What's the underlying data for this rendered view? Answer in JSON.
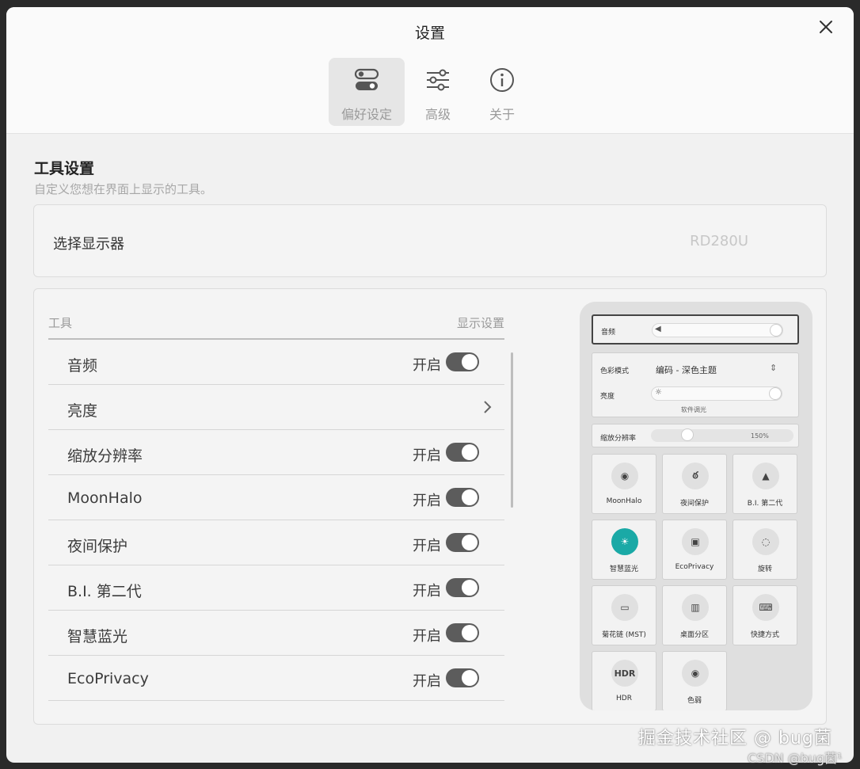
{
  "window": {
    "title": "设置"
  },
  "tabs": [
    {
      "label": "偏好设定",
      "icon": "toggles-icon",
      "active": true
    },
    {
      "label": "高级",
      "icon": "sliders-icon",
      "active": false
    },
    {
      "label": "关于",
      "icon": "info-icon",
      "active": false
    }
  ],
  "section": {
    "title": "工具设置",
    "subtitle": "自定义您想在界面上显示的工具。"
  },
  "monitor": {
    "label": "选择显示器",
    "value": "RD280U"
  },
  "tools": {
    "col_tool": "工具",
    "col_display": "显示设置",
    "rows": [
      {
        "label": "音频",
        "state": "开启",
        "type": "toggle"
      },
      {
        "label": "亮度",
        "state": "",
        "type": "chevron"
      },
      {
        "label": "缩放分辨率",
        "state": "开启",
        "type": "toggle"
      },
      {
        "label": "MoonHalo",
        "state": "开启",
        "type": "toggle"
      },
      {
        "label": "夜间保护",
        "state": "开启",
        "type": "toggle"
      },
      {
        "label": "B.I. 第二代",
        "state": "开启",
        "type": "toggle"
      },
      {
        "label": "智慧蓝光",
        "state": "开启",
        "type": "toggle"
      },
      {
        "label": "EcoPrivacy",
        "state": "开启",
        "type": "toggle"
      }
    ]
  },
  "preview": {
    "audio_label": "音频",
    "color_mode_label": "色彩模式",
    "color_mode_value": "编码 - 深色主题",
    "brightness_label": "亮度",
    "brightness_sub": "软件调光",
    "scaling_label": "缩放分辨率",
    "scaling_value": "150%",
    "tiles": [
      {
        "label": "MoonHalo",
        "icon": "moonhalo-icon",
        "glyph": "◉"
      },
      {
        "label": "夜间保护",
        "icon": "owl-icon",
        "glyph": "ఠ"
      },
      {
        "label": "B.I. 第二代",
        "icon": "bi-icon",
        "glyph": "▲"
      },
      {
        "label": "智慧蓝光",
        "icon": "bulb-icon",
        "glyph": "☀",
        "accent": "#1aa9a6"
      },
      {
        "label": "EcoPrivacy",
        "icon": "eco-privacy-icon",
        "glyph": "▣"
      },
      {
        "label": "旋转",
        "icon": "rotate-icon",
        "glyph": "◌"
      },
      {
        "label": "菊花链 (MST)",
        "icon": "daisy-chain-icon",
        "glyph": "▭"
      },
      {
        "label": "桌面分区",
        "icon": "desktop-partition-icon",
        "glyph": "▥"
      },
      {
        "label": "快捷方式",
        "icon": "shortcut-icon",
        "glyph": "⌨"
      },
      {
        "label": "HDR",
        "icon": "hdr-icon",
        "glyph": "HDR"
      },
      {
        "label": "色弱",
        "icon": "eye-icon",
        "glyph": "◉"
      }
    ]
  },
  "watermark": {
    "line1": "掘金技术社区 @ bug菌",
    "line2": "CSDN @bug菌¹"
  }
}
